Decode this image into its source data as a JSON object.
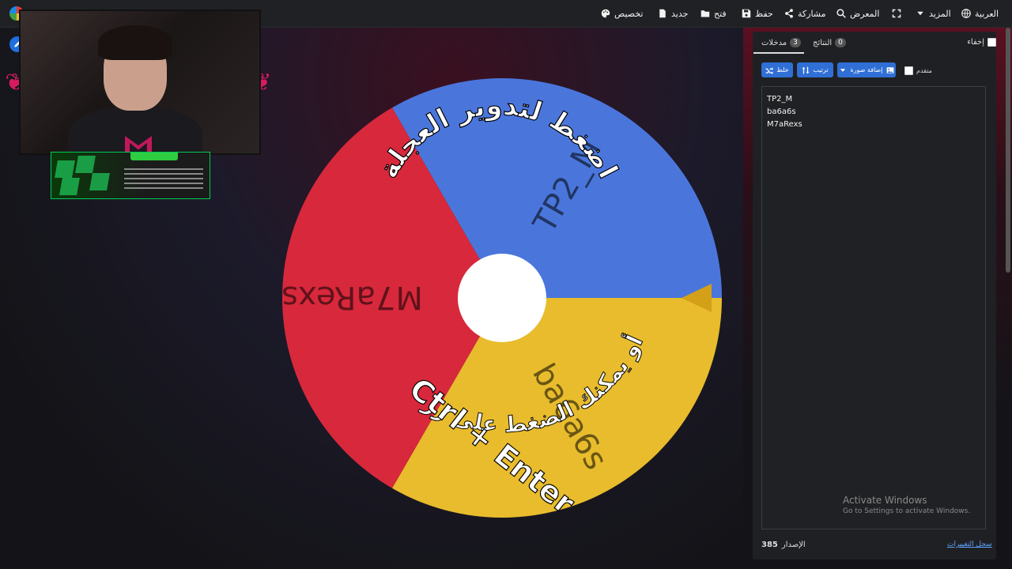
{
  "topbar": {
    "language": "العربية",
    "more": "المزيد",
    "gallery": "المعرض",
    "share": "مشاركة",
    "save": "حفظ",
    "open": "فتح",
    "new": "جديد",
    "customize": "تخصيص"
  },
  "wheel": {
    "entries": [
      "TP2_M",
      "ba6a6s",
      "M7aRexs"
    ],
    "colors": [
      "#4a76dc",
      "#e8bc2c",
      "#d8283c"
    ],
    "hint_top": "اضغط لتدوير العجلة",
    "hint_bottom": "أو يمكنك الضغط على زر",
    "hint_keys": "Ctrl + Enter"
  },
  "panel": {
    "hide_label": "إخفاء",
    "tab_entries": "مدخلات",
    "tab_entries_count": "3",
    "tab_results": "النتائج",
    "tab_results_count": "0",
    "shuffle_label": "خلط",
    "sort_label": "ترتيب",
    "add_image_label": "إضافة صورة",
    "advanced_label": "متقدم",
    "entries_text": [
      "TP2_M",
      "ba6a6s",
      "M7aRexs"
    ],
    "version_label": "الإصدار",
    "version_number": "385",
    "changelog_label": "سجل التغييرات"
  },
  "watermark": {
    "title": "Activate Windows",
    "subtitle": "Go to Settings to activate Windows."
  },
  "icons": [
    "globe-icon",
    "caret-down-icon",
    "fullscreen-icon",
    "search-icon",
    "share-icon",
    "save-icon",
    "folder-icon",
    "file-icon",
    "palette-icon",
    "pencil-icon",
    "shuffle-icon",
    "sort-icon",
    "image-icon"
  ]
}
